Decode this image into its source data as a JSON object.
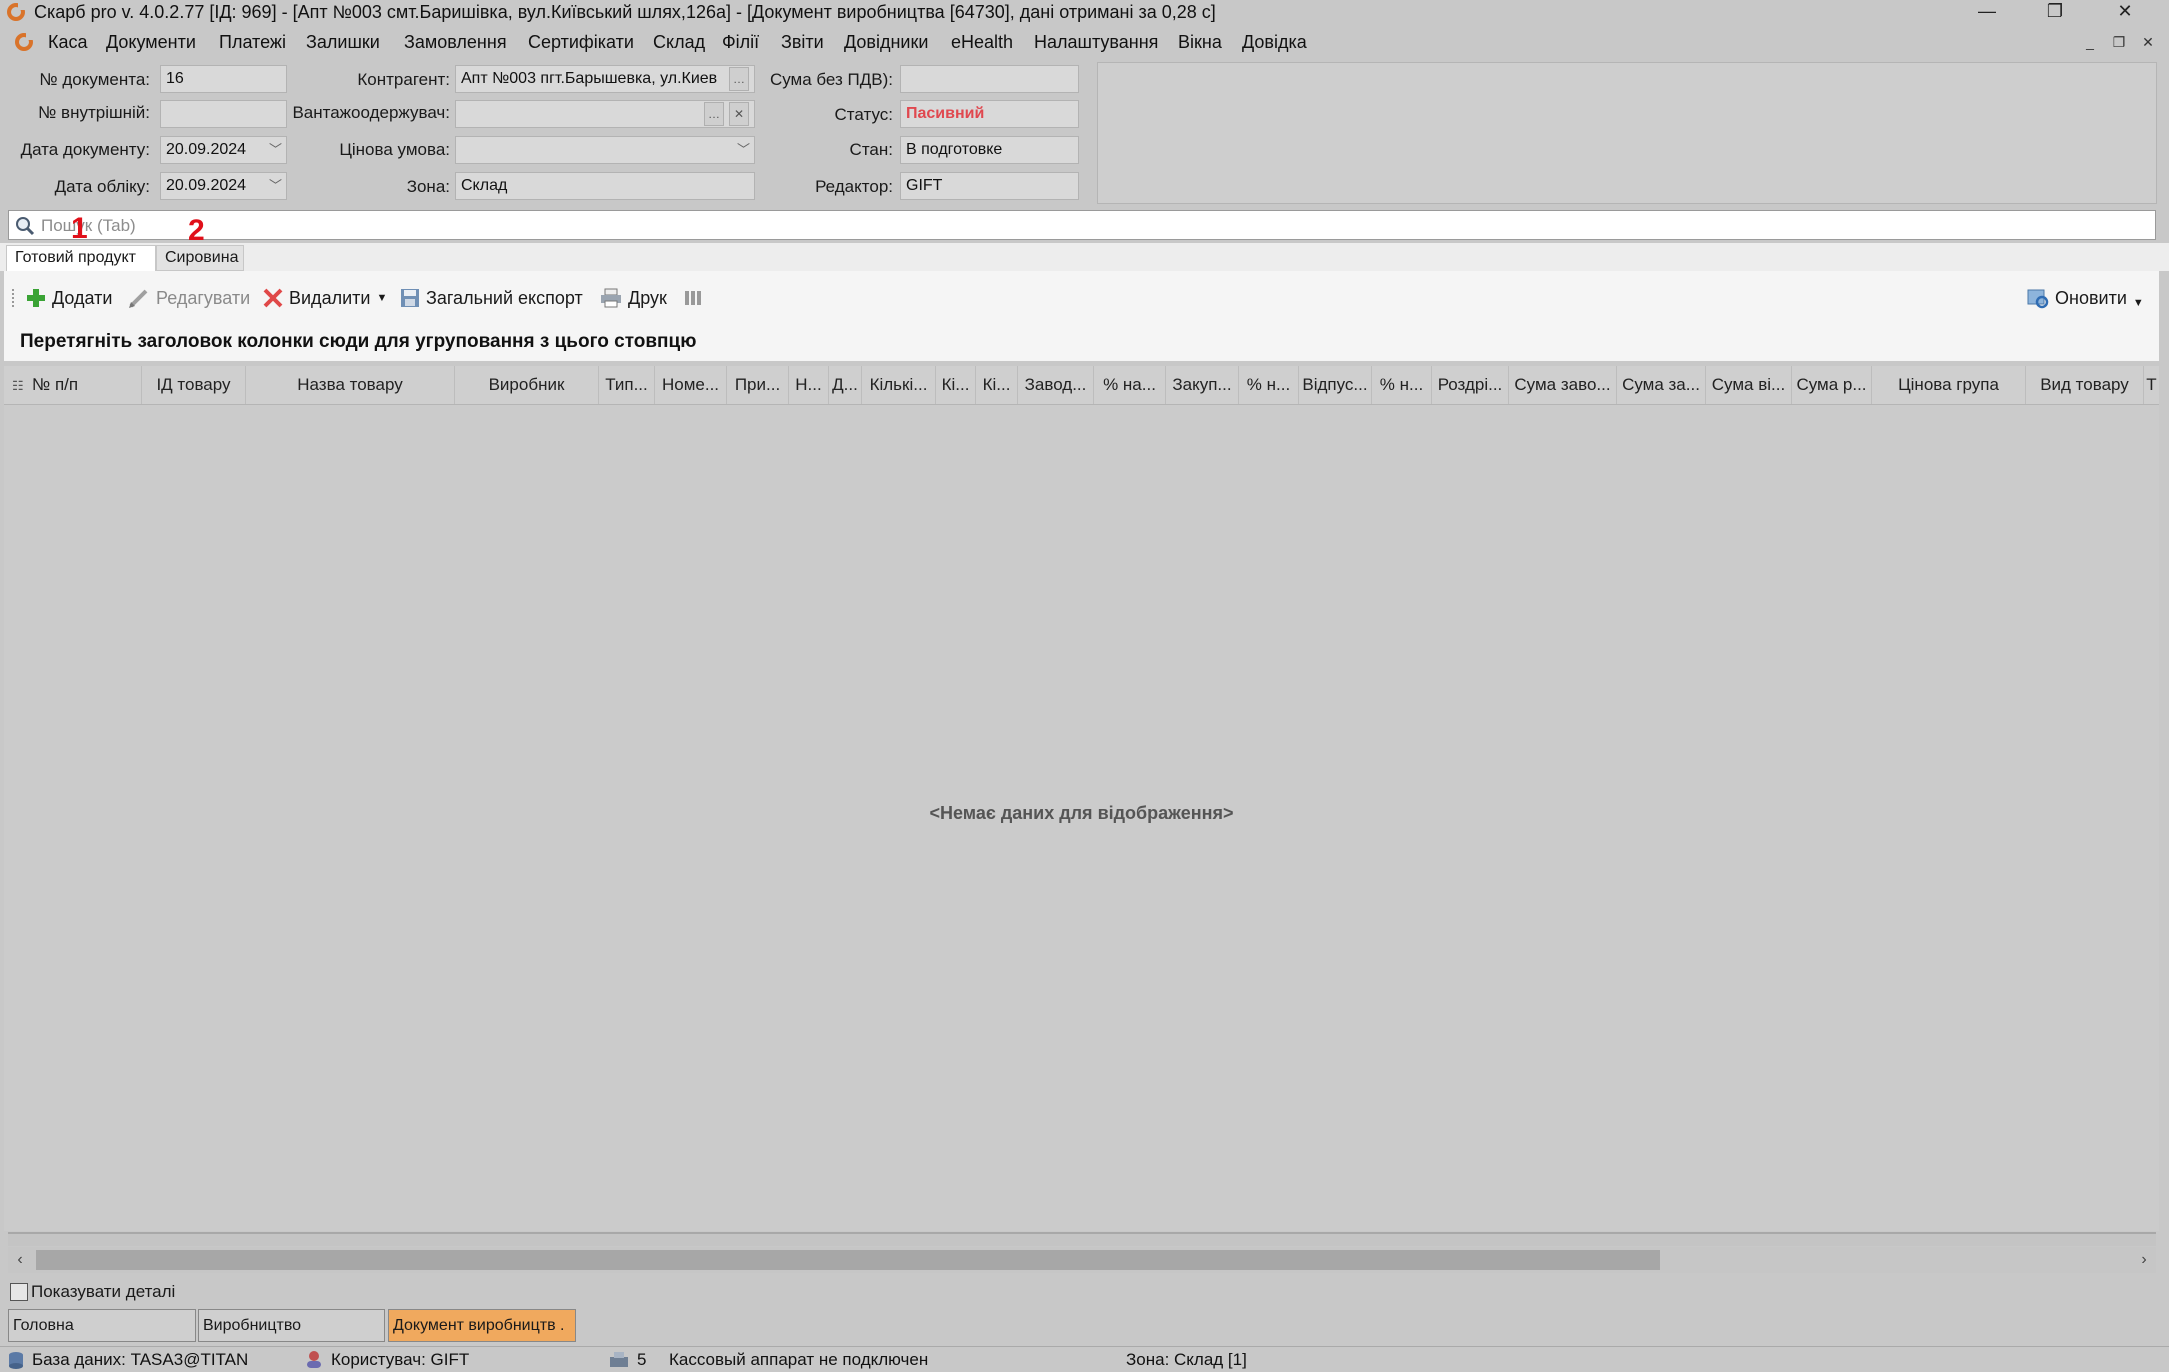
{
  "window": {
    "title": "Скарб pro v. 4.0.2.77 [ІД: 969] - [Апт №003 смт.Баришівка, вул.Київський шлях,126а] - [Документ виробництва [64730], дані отримані за 0,28 с]",
    "minimize": "—",
    "restore": "❐",
    "close": "✕"
  },
  "menu": {
    "items": [
      "Каса",
      "Документи",
      "Платежі",
      "Залишки",
      "Замовлення",
      "Сертифікати",
      "Склад",
      "Філії",
      "Звіти",
      "Довідники",
      "eHealth",
      "Налаштування",
      "Вікна",
      "Довідка"
    ]
  },
  "header": {
    "doc_number_label": "№ документа:",
    "doc_number": "16",
    "internal_label": "№ внутрішній:",
    "internal": "",
    "doc_date_label": "Дата документу:",
    "doc_date": "20.09.2024",
    "account_date_label": "Дата обліку:",
    "account_date": "20.09.2024",
    "counterparty_label": "Контрагент:",
    "counterparty": "Апт №003 пгт.Барышевка, ул.Киев",
    "consignee_label": "Вантажоодержувач:",
    "consignee": "",
    "price_condition_label": "Цінова умова:",
    "price_condition": "",
    "zone_label": "Зона:",
    "zone": "Склад",
    "sum_no_vat_label": "Сума без ПДВ):",
    "sum_no_vat": "",
    "status_label": "Статус:",
    "status": "Пасивний",
    "state_label": "Стан:",
    "state": "В подготовке",
    "editor_label": "Редактор:",
    "editor": "GIFT",
    "status_color": "#e0484f"
  },
  "search": {
    "placeholder": "Пошук (Tab)",
    "marker1": "1",
    "marker2": "2"
  },
  "tabs": [
    "Готовий продукт",
    "Сировина"
  ],
  "toolbar": {
    "add": "Додати",
    "edit": "Редагувати",
    "delete": "Видалити",
    "export": "Загальний експорт",
    "print": "Друк",
    "refresh": "Оновити"
  },
  "grid": {
    "group_hint": "Перетягніть заголовок колонки сюди для угруповання з цього стовпцю",
    "columns": [
      "№ п/п",
      "ІД товару",
      "Назва товару",
      "Виробник",
      "Тип...",
      "Номе...",
      "При...",
      "Н...",
      "Д...",
      "Кількі...",
      "Кі...",
      "Кі...",
      "Завод...",
      "% на...",
      "Закуп...",
      "% н...",
      "Відпус...",
      "% н...",
      "Роздрі...",
      "Сума заво...",
      "Сума за...",
      "Сума ві...",
      "Сума р...",
      "Цінова група",
      "Вид товару",
      "Т"
    ],
    "empty_text": "<Немає даних для відображення>"
  },
  "bottom": {
    "show_details": "Показувати деталі",
    "window_tabs": [
      "Головна",
      "Виробництво",
      "Документ виробництв ."
    ],
    "active_tab_color": "#f0a95e"
  },
  "statusbar": {
    "database": "База даних: TASA3@TITAN",
    "user": "Користувач: GIFT",
    "count": "5",
    "cash_register": "Кассовый аппарат не подключен",
    "zone": "Зона: Склад [1]"
  }
}
